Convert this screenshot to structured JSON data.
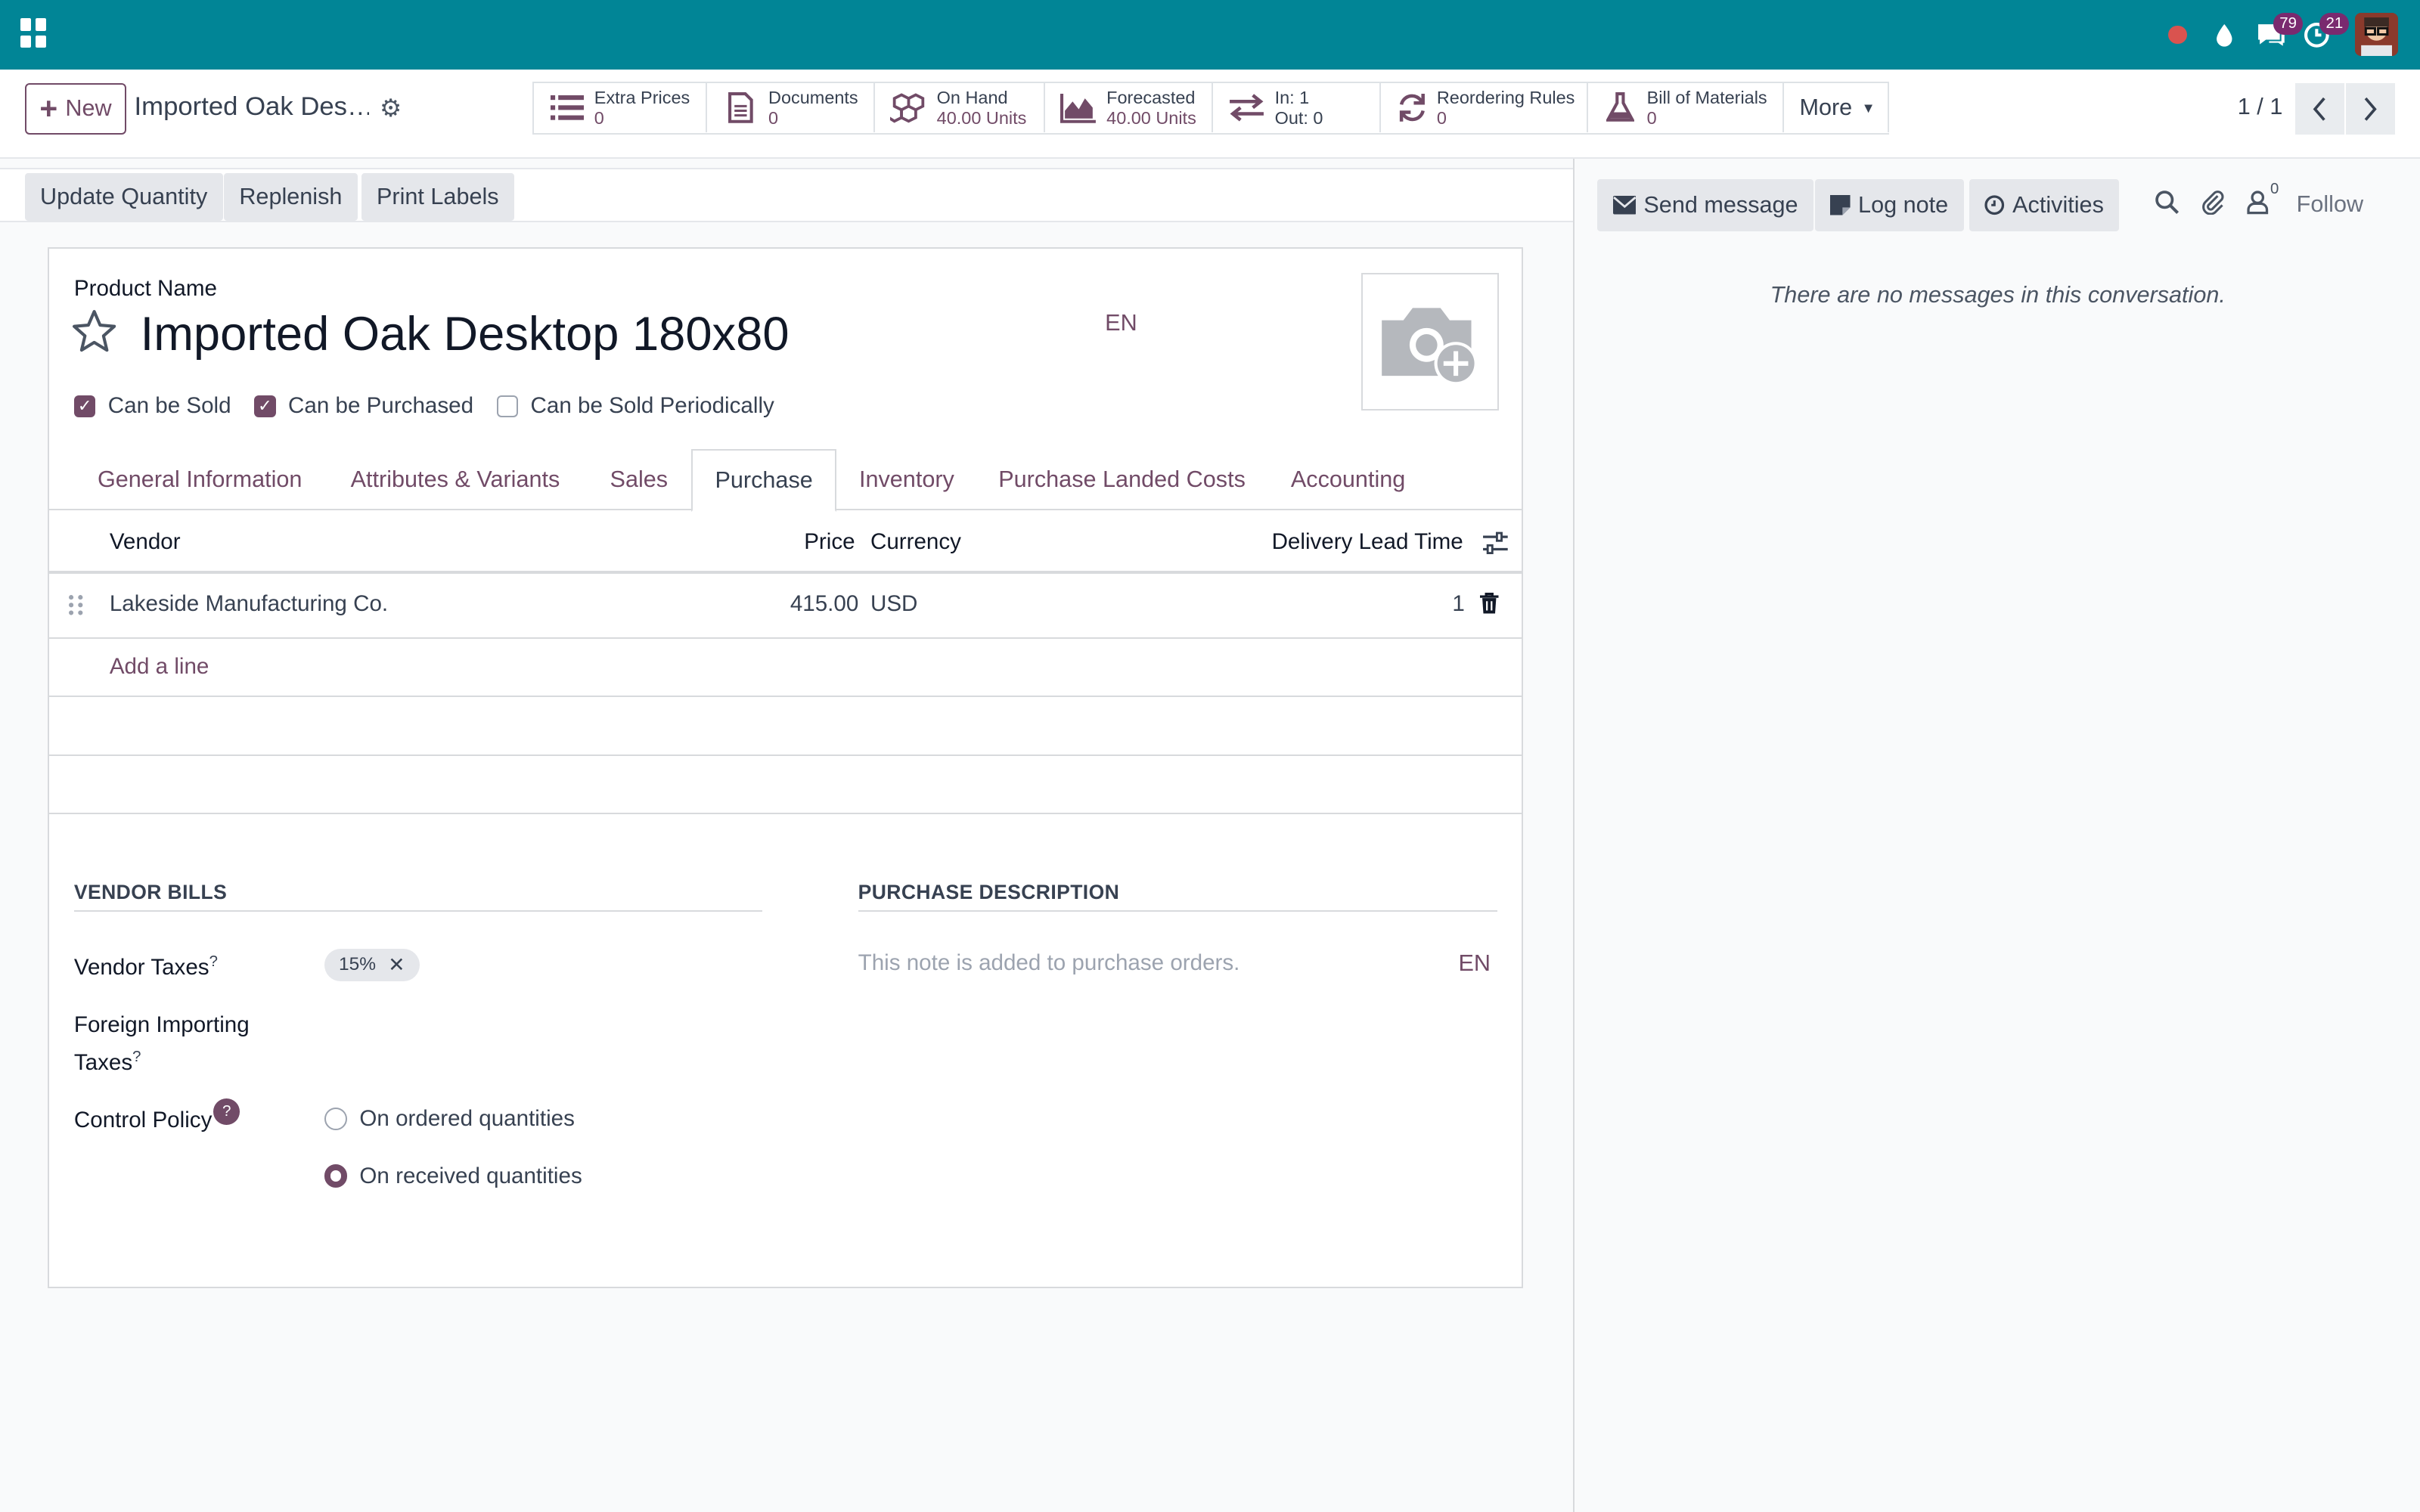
{
  "navbar": {
    "messages_count": "79",
    "activities_count": "21"
  },
  "control_panel": {
    "new_label": "New",
    "breadcrumb_title": "Imported Oak Des…",
    "smart_buttons": [
      {
        "label": "Extra Prices",
        "value": "0",
        "icon": "list-icon"
      },
      {
        "label": "Documents",
        "value": "0",
        "icon": "document-icon"
      },
      {
        "label": "On Hand",
        "value": "40.00 Units",
        "icon": "cubes-icon"
      },
      {
        "label": "Forecasted",
        "value": "40.00 Units",
        "icon": "area-chart-icon"
      },
      {
        "label": "In: 1",
        "value": "Out: 0",
        "icon": "exchange-icon"
      },
      {
        "label": "Reordering Rules",
        "value": "0",
        "icon": "refresh-icon"
      },
      {
        "label": "Bill of Materials",
        "value": "0",
        "icon": "flask-icon"
      }
    ],
    "more_label": "More",
    "pager": "1 / 1"
  },
  "action_bar": {
    "update_quantity": "Update Quantity",
    "replenish": "Replenish",
    "print_labels": "Print Labels"
  },
  "form": {
    "product_name_label": "Product Name",
    "product_name": "Imported Oak Desktop 180x80",
    "lang": "EN",
    "checkboxes": [
      {
        "label": "Can be Sold",
        "checked": true
      },
      {
        "label": "Can be Purchased",
        "checked": true
      },
      {
        "label": "Can be Sold Periodically",
        "checked": false
      }
    ],
    "tabs": [
      "General Information",
      "Attributes & Variants",
      "Sales",
      "Purchase",
      "Inventory",
      "Purchase Landed Costs",
      "Accounting"
    ],
    "active_tab": "Purchase",
    "vendor_table": {
      "headers": {
        "vendor": "Vendor",
        "price": "Price",
        "currency": "Currency",
        "lead_time": "Delivery Lead Time"
      },
      "rows": [
        {
          "vendor": "Lakeside Manufacturing Co.",
          "price": "415.00",
          "currency": "USD",
          "lead_time": "1"
        }
      ],
      "add_line": "Add a line"
    },
    "vendor_bills": {
      "title": "VENDOR BILLS",
      "vendor_taxes_label": "Vendor Taxes",
      "vendor_taxes_tag": "15%",
      "foreign_label_1": "Foreign Importing",
      "foreign_label_2": "Taxes",
      "control_policy_label": "Control Policy",
      "help": "?",
      "tooltip_mark": "?",
      "policy_options": [
        {
          "label": "On ordered quantities",
          "selected": false
        },
        {
          "label": "On received quantities",
          "selected": true
        }
      ]
    },
    "purchase_description": {
      "title": "PURCHASE DESCRIPTION",
      "placeholder": "This note is added to purchase orders.",
      "lang": "EN"
    }
  },
  "chatter": {
    "send_message": "Send message",
    "log_note": "Log note",
    "activities": "Activities",
    "followers_count": "0",
    "follow": "Follow",
    "empty": "There are no messages in this conversation."
  },
  "colors": {
    "navbar": "#018596",
    "accent": "#714b67"
  }
}
